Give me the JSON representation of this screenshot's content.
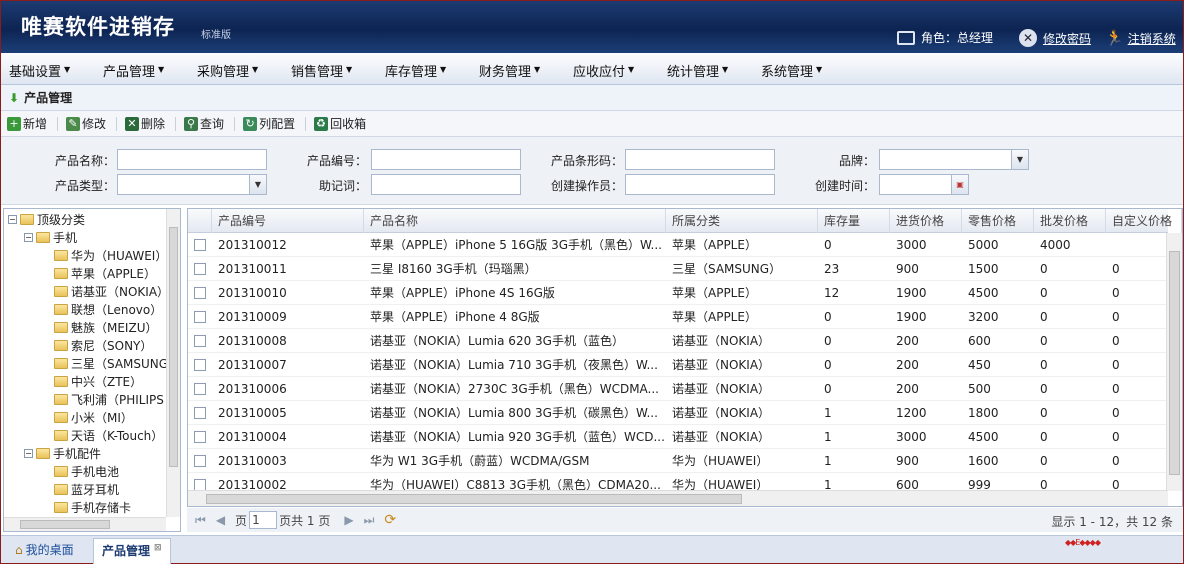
{
  "header": {
    "app_title": "唯赛软件进销存",
    "edition": "标准版",
    "role_label": "角色：总经理",
    "change_password": "修改密码",
    "logout": "注销系统"
  },
  "menu": [
    "基础设置",
    "产品管理",
    "采购管理",
    "销售管理",
    "库存管理",
    "财务管理",
    "应收应付",
    "统计管理",
    "系统管理"
  ],
  "page_title": "产品管理",
  "toolbar": {
    "add": "新增",
    "edit": "修改",
    "delete": "删除",
    "query": "查询",
    "columns": "列配置",
    "recycle": "回收箱"
  },
  "search": {
    "name_label": "产品名称：",
    "code_label": "产品编号：",
    "barcode_label": "产品条形码：",
    "brand_label": "品牌：",
    "type_label": "产品类型：",
    "mnemonic_label": "助记词：",
    "creator_label": "创建操作员：",
    "created_label": "创建时间："
  },
  "tree": {
    "root": "顶级分类",
    "phone": "手机",
    "brands": [
      "华为（HUAWEI）",
      "苹果（APPLE）",
      "诺基亚（NOKIA）",
      "联想（Lenovo）",
      "魅族（MEIZU）",
      "索尼（SONY）",
      "三星（SAMSUNG",
      "中兴（ZTE）",
      "飞利浦（PHILIPS",
      "小米（MI）",
      "天语（K-Touch）"
    ],
    "accessories": "手机配件",
    "acc_items": [
      "手机电池",
      "蓝牙耳机",
      "手机存储卡"
    ]
  },
  "grid": {
    "columns": [
      "产品编号",
      "产品名称",
      "所属分类",
      "库存量",
      "进货价格",
      "零售价格",
      "批发价格",
      "自定义价格"
    ],
    "rows": [
      [
        "201310012",
        "苹果（APPLE）iPhone 5 16G版 3G手机（黑色）W...",
        "苹果（APPLE）",
        "0",
        "3000",
        "5000",
        "4000",
        ""
      ],
      [
        "201310011",
        "三星 I8160 3G手机（玛瑙黑）",
        "三星（SAMSUNG）",
        "23",
        "900",
        "1500",
        "0",
        "0"
      ],
      [
        "201310010",
        "苹果（APPLE）iPhone 4S 16G版",
        "苹果（APPLE）",
        "12",
        "1900",
        "4500",
        "0",
        "0"
      ],
      [
        "201310009",
        "苹果（APPLE）iPhone 4 8G版",
        "苹果（APPLE）",
        "0",
        "1900",
        "3200",
        "0",
        "0"
      ],
      [
        "201310008",
        "诺基亚（NOKIA）Lumia 620 3G手机（蓝色）",
        "诺基亚（NOKIA）",
        "0",
        "200",
        "600",
        "0",
        "0"
      ],
      [
        "201310007",
        "诺基亚（NOKIA）Lumia 710 3G手机（夜黑色）W...",
        "诺基亚（NOKIA）",
        "0",
        "200",
        "450",
        "0",
        "0"
      ],
      [
        "201310006",
        "诺基亚（NOKIA）2730C 3G手机（黑色）WCDMA...",
        "诺基亚（NOKIA）",
        "0",
        "200",
        "500",
        "0",
        "0"
      ],
      [
        "201310005",
        "诺基亚（NOKIA）Lumia 800 3G手机（碳黑色）W...",
        "诺基亚（NOKIA）",
        "1",
        "1200",
        "1800",
        "0",
        "0"
      ],
      [
        "201310004",
        "诺基亚（NOKIA）Lumia 920 3G手机（蓝色）WCD...",
        "诺基亚（NOKIA）",
        "1",
        "3000",
        "4500",
        "0",
        "0"
      ],
      [
        "201310003",
        "华为 W1 3G手机（蔚蓝）WCDMA/GSM",
        "华为（HUAWEI）",
        "1",
        "900",
        "1600",
        "0",
        "0"
      ],
      [
        "201310002",
        "华为（HUAWEI）C8813 3G手机（黑色）CDMA20...",
        "华为（HUAWEI）",
        "1",
        "600",
        "999",
        "0",
        "0"
      ]
    ]
  },
  "pager": {
    "page_label": "页",
    "page_value": "1",
    "total": "页共 1 页",
    "info": "显示 1 - 12，共 12 条"
  },
  "footer": {
    "desktop_tab": "我的桌面",
    "product_tab": "产品管理"
  }
}
